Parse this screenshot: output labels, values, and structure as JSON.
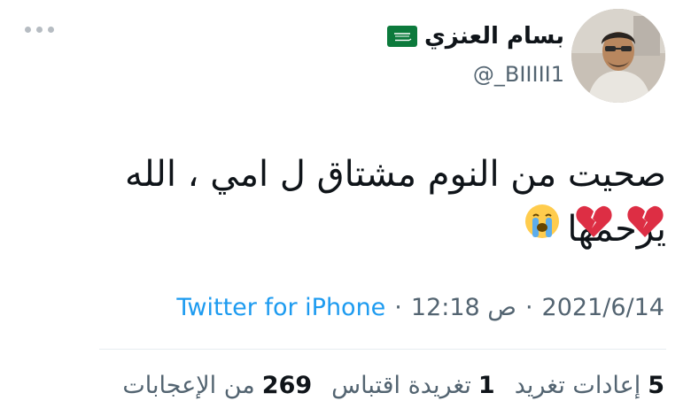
{
  "user": {
    "display_name": "بسام العنزي",
    "handle": "@_BIIIII1",
    "flag_icon": "saudi-flag-icon"
  },
  "tweet": {
    "text": "صحيت من النوم مشتاق ل امي ، الله يرحمها",
    "emojis": [
      "💔",
      "💔",
      "😭"
    ]
  },
  "meta": {
    "date": "2021/6/14",
    "time": "12:18 ص",
    "source": "Twitter for iPhone"
  },
  "stats": [
    {
      "count": "5",
      "label": "إعادات تغريد"
    },
    {
      "count": "1",
      "label": "تغريدة اقتباس"
    },
    {
      "count": "269",
      "label": "من الإعجابات"
    }
  ],
  "colors": {
    "source_link": "#1d9bf0",
    "secondary_text": "#536471",
    "primary_text": "#0f1419"
  }
}
